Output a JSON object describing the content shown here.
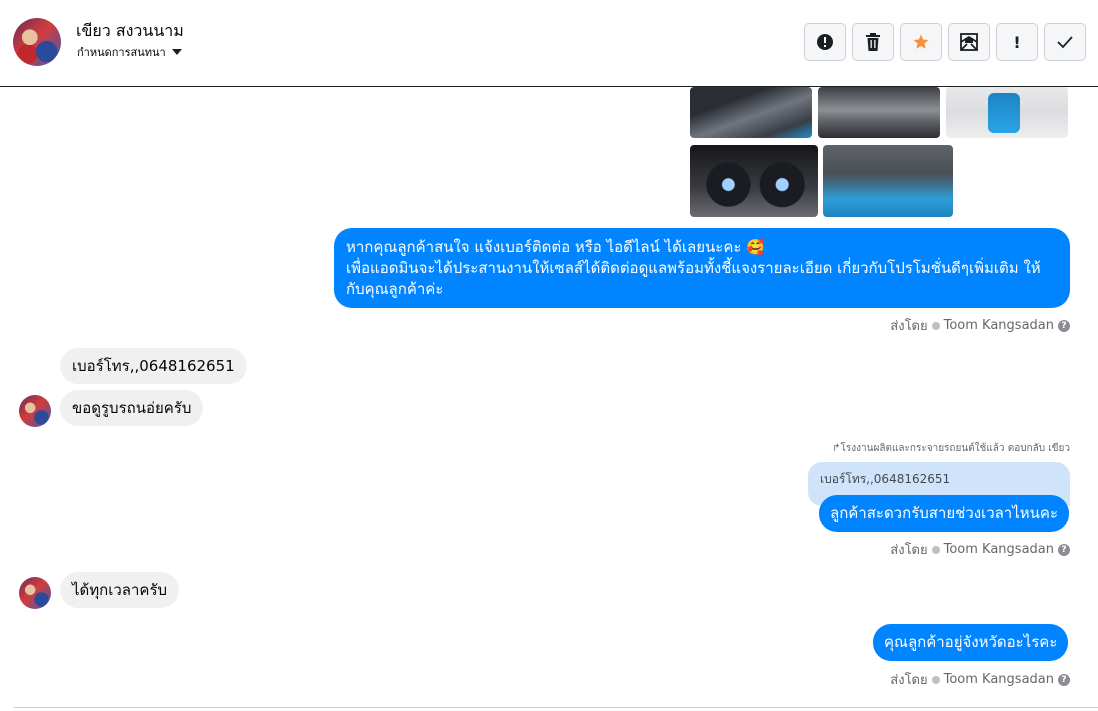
{
  "header": {
    "contact_name": "เขียว สงวนนาม",
    "contact_sub": "กำหนดการสนทนา",
    "toolbar": {
      "spam_icon": "exclamation-circle-icon",
      "delete_icon": "trash-icon",
      "star_icon": "star-icon",
      "unread_icon": "envelope-icon",
      "important_label": "!",
      "done_icon": "check-icon"
    },
    "star_color": "#f7923a"
  },
  "messages": {
    "photo_icons": [
      "car-interior-seats-photo",
      "car-interior-cabin-photo",
      "car-exterior-rear-photo",
      "car-dashboard-photo",
      "car-engine-photo"
    ],
    "out_1": {
      "line1": "หากคุณลูกค้าสนใจ แจ้งเบอร์ติดต่อ หรือ ไอดีไลน์ ได้เลยนะคะ 🥰",
      "line2": "เพื่อแอดมินจะได้ประสานงานให้เซลส์ได้ติดต่อดูแลพร้อมทั้งชี้แจงรายละเอียด เกี่ยวกับโปรโมชั่นดีๆเพิ่มเติม ให้",
      "line3": "กับคุณลูกค้าค่ะ"
    },
    "sent_by_1": {
      "prefix": "ส่งโดย",
      "name": "Toom Kangsadan"
    },
    "in_1": "เบอร์โทร,,0648162651",
    "in_2": "ขอดูรูบรถนอ่ยครับ",
    "reply_meta": "↱โรงงานผลิตและกระจายรถยนต์ใช้แล้ว ตอบกลับ เขียว",
    "quoted": "เบอร์โทร,,0648162651",
    "out_2": "ลูกค้าสะดวกรับสายช่วงเวลาไหนคะ",
    "sent_by_2": {
      "prefix": "ส่งโดย",
      "name": "Toom Kangsadan"
    },
    "in_3": "ได้ทุกเวลาครับ",
    "out_3": "คุณลูกค้าอยู่จังหวัดอะไรคะ",
    "sent_by_3": {
      "prefix": "ส่งโดย",
      "name": "Toom Kangsadan"
    }
  }
}
